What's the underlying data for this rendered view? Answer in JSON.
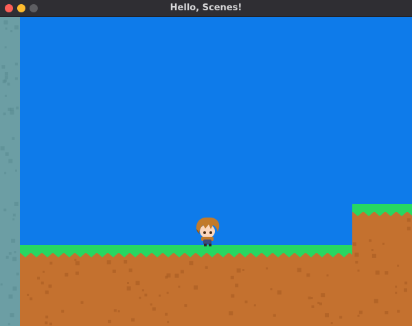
{
  "window": {
    "title": "Hello, Scenes!",
    "buttons": [
      "close",
      "minimize",
      "zoom"
    ]
  },
  "colors": {
    "sky": "#0e7bea",
    "grass": "#27d761",
    "grass_dark": "#1cb84f",
    "dirt": "#c4712f",
    "dirt_dark": "#a65a20",
    "wall": "#6c9ea4",
    "wall_dark": "#5a8a90",
    "hair": "#c17a2a",
    "hair_dark": "#8a5218",
    "skin": "#fbd7bd",
    "close": "#fe5f57",
    "minimize": "#febc2e",
    "zoom": "#5e5e62"
  },
  "scene": {
    "elements": [
      "left-stone-wall",
      "main-ground",
      "raised-ledge",
      "player-character"
    ],
    "player_icon": "chibi-brown-hair-character"
  }
}
